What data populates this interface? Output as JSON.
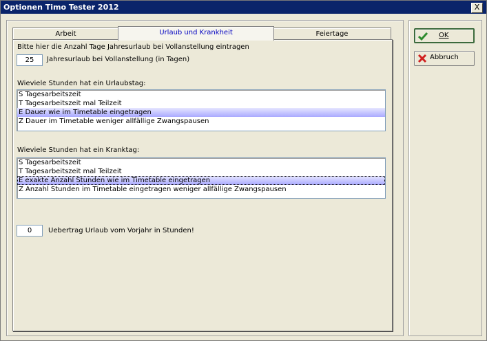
{
  "window": {
    "title": "Optionen Timo Tester 2012",
    "close_glyph": "X"
  },
  "tabs": [
    {
      "label": "Arbeit",
      "active": false
    },
    {
      "label": "Urlaub und Krankheit",
      "active": true
    },
    {
      "label": "Feiertage",
      "active": false
    }
  ],
  "urlaub": {
    "intro": "Bitte hier die Anzahl Tage Jahresurlaub bei Vollanstellung eintragen",
    "days_value": "25",
    "days_label": "Jahresurlaub bei Vollanstellung (in Tagen)"
  },
  "urlaubstag": {
    "question": "Wieviele Stunden hat ein Urlaubstag:",
    "items": [
      "S Tagesarbeitszeit",
      "T Tagesarbeitszeit mal Teilzeit",
      "E Dauer wie im Timetable eingetragen",
      "Z Dauer im Timetable weniger allfällige Zwangspausen"
    ],
    "selected_index": 2
  },
  "kranktag": {
    "question": "Wieviele Stunden hat ein Kranktag:",
    "items": [
      "S Tagesarbeitszeit",
      "T Tagesarbeitszeit mal Teilzeit",
      "E exakte Anzahl Stunden wie im Timetable eingetragen",
      "Z Anzahl Stunden im Timetable eingetragen weniger allfällige Zwangspausen"
    ],
    "selected_index": 2
  },
  "uebertrag": {
    "value": "0",
    "label": "Uebertrag Urlaub vom Vorjahr in Stunden!"
  },
  "buttons": {
    "ok_label": "OK",
    "ok_icon": "check-icon",
    "cancel_label": "Abbruch",
    "cancel_icon": "cross-icon"
  },
  "colors": {
    "titlebar": "#0a246a",
    "active_tab_text": "#0000c0",
    "selection": "#aaaaff",
    "check": "#2e8b2e",
    "cross": "#d02020"
  }
}
